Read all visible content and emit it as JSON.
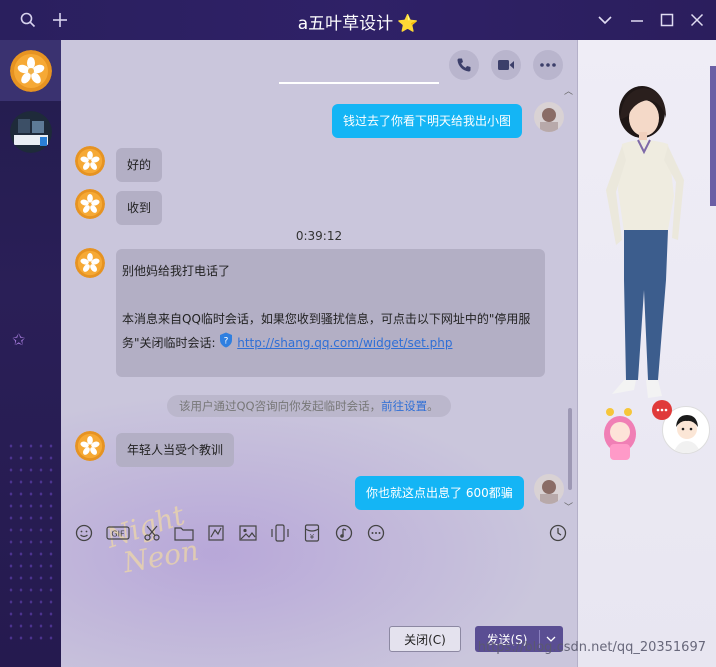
{
  "window": {
    "title": "a五叶草设计",
    "title_badge": "⭐",
    "controls": [
      "search",
      "add",
      "chevron-down",
      "minimize",
      "maximize",
      "close"
    ]
  },
  "rail": {
    "items": [
      {
        "name": "contact-wuyecao",
        "active": true
      },
      {
        "name": "contact-group",
        "active": false
      }
    ]
  },
  "chat": {
    "header_actions": [
      "phone",
      "video",
      "more"
    ],
    "timestamp": "0:39:12",
    "messages": [
      {
        "side": "me",
        "text": "钱过去了你看下明天给我出小图"
      },
      {
        "side": "other",
        "text": "好的"
      },
      {
        "side": "other",
        "text": "收到"
      },
      {
        "side": "other",
        "lines": [
          "别他妈给我打电话了",
          "",
          "本消息来自QQ临时会话，如果您收到骚扰信息，可点击以下网址中的\"停用服",
          "务\"关闭临时会话: "
        ],
        "link": "http://shang.qq.com/widget/set.php"
      },
      {
        "side": "other",
        "text": "年轻人当受个教训"
      },
      {
        "side": "me",
        "text": "你也就这点出息了 600都骗"
      }
    ],
    "system_note": {
      "text": "该用户通过QQ咨询向你发起临时会话，",
      "link": "前往设置",
      "end": "。"
    },
    "input_tools": [
      "emoji",
      "gif",
      "scissors",
      "folder",
      "doodle",
      "image",
      "shake",
      "red-packet",
      "music",
      "more"
    ],
    "buttons": {
      "close": "关闭(C)",
      "send": "发送(S)"
    }
  },
  "watermark": "https://blog.csdn.net/qq_20351697",
  "colors": {
    "titlebar": "#2b1f5e",
    "bubble_me": "#14b5f5",
    "bubble_other": "#b3afc5",
    "send_button": "#5a4e93",
    "link": "#2f6fd6"
  }
}
